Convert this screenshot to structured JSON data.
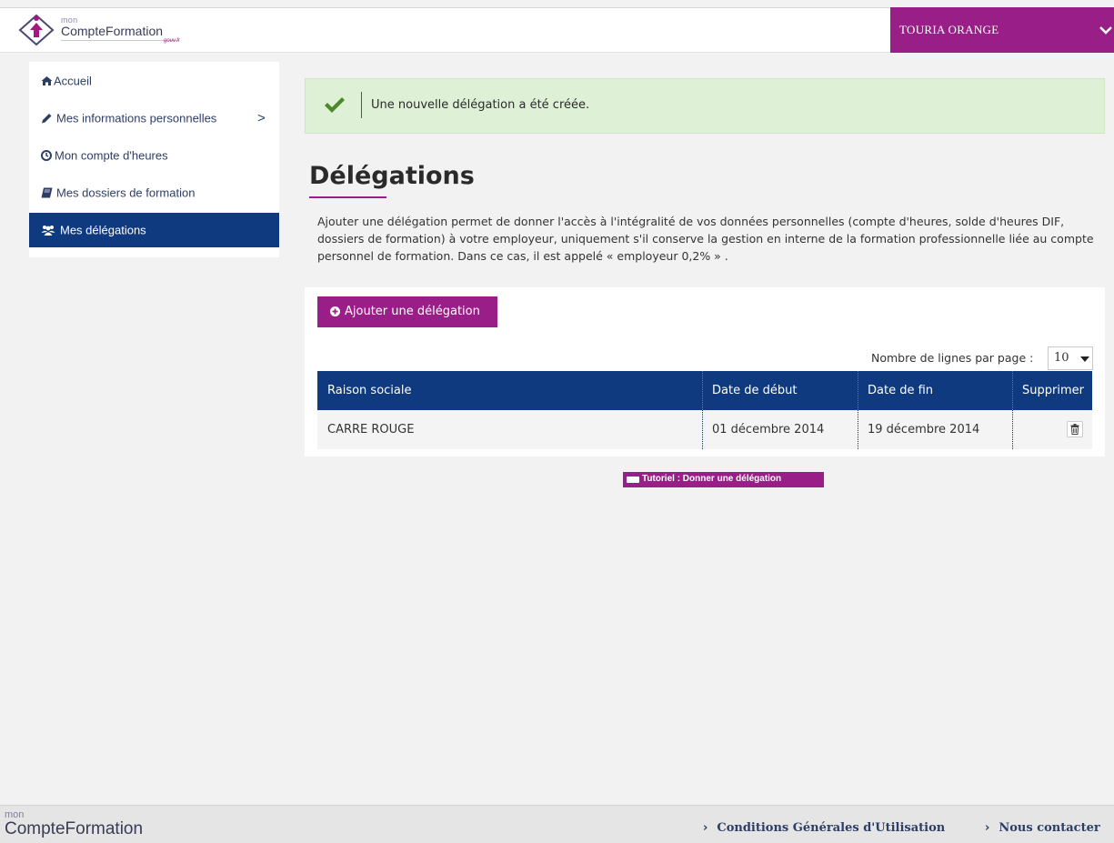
{
  "header": {
    "logo_small": "mon",
    "logo_big": "CompteFormation",
    "logo_tag": "gouv.fr",
    "user_name": "TOURIA ORANGE"
  },
  "sidebar": {
    "items": [
      {
        "label": "Accueil",
        "icon": "home-icon",
        "active": false
      },
      {
        "label": "Mes informations personnelles",
        "icon": "pencil-icon",
        "active": false,
        "has_chevron": true,
        "chevron": ">"
      },
      {
        "label": "Mon compte d'heures",
        "icon": "clock-icon",
        "active": false
      },
      {
        "label": "Mes dossiers de formation",
        "icon": "book-icon",
        "active": false
      },
      {
        "label": "Mes délégations",
        "icon": "users-icon",
        "active": true
      }
    ]
  },
  "alert": {
    "text": "Une nouvelle délégation a été créée.",
    "icon": "check-icon",
    "color": "#def0d6"
  },
  "main": {
    "title": "Délégations",
    "intro": "Ajouter une délégation permet de donner l'accès à l'intégralité de vos données personnelles (compte d'heures, solde d'heures DIF, dossiers de formation) à votre employeur, uniquement s'il conserve la gestion en interne de la formation professionnelle liée au compte personnel de formation. Dans ce cas, il est appelé  « employeur 0,2% » .",
    "add_button_label": "Ajouter une délégation",
    "per_page_label": "Nombre de lignes par page :",
    "per_page_value": "10",
    "table": {
      "headers": [
        "Raison sociale",
        "Date de début",
        "Date de fin",
        "Supprimer"
      ],
      "rows": [
        {
          "raison_sociale": "CARRE ROUGE",
          "date_debut": "01 décembre 2014",
          "date_fin": "19 décembre 2014",
          "action_icon": "trash-icon"
        }
      ]
    },
    "tutorial_label": "Tutoriel : Donner une délégation"
  },
  "footer": {
    "logo_small": "mon",
    "logo_big": "CompteFormation",
    "links": [
      "Conditions Générales d'Utilisation",
      "Nous contacter"
    ],
    "link_arrow": "›"
  },
  "colors": {
    "brand_purple": "#9a1e87",
    "brand_blue": "#0f3a80",
    "success_green": "#4b8a2a"
  }
}
